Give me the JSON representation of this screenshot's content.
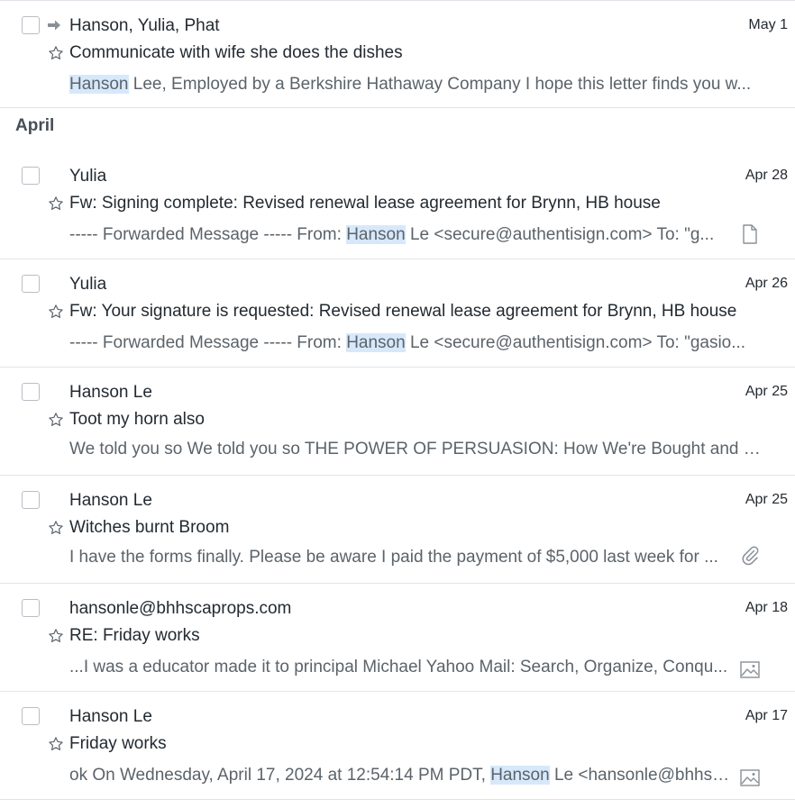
{
  "section": {
    "label": "April"
  },
  "messages": [
    {
      "sender": "Hanson, Yulia, Phat",
      "date": "May 1",
      "subject": "Communicate with wife she does the dishes",
      "snippet_pre": "",
      "snippet_hl": "Hanson",
      "snippet_post": " Lee, Employed by a Berkshire Hathaway Company I hope this letter finds you w...",
      "forwarded": true,
      "attachment": ""
    },
    {
      "sender": "Yulia",
      "date": "Apr 28",
      "subject": "Fw: Signing complete: Revised renewal lease agreement for Brynn, HB house",
      "snippet_pre": "----- Forwarded Message ----- From: ",
      "snippet_hl": "Hanson",
      "snippet_post": " Le <secure@authentisign.com> To: \"g...",
      "forwarded": false,
      "attachment": "document-icon"
    },
    {
      "sender": "Yulia",
      "date": "Apr 26",
      "subject": "Fw: Your signature is requested: Revised renewal lease agreement for Brynn, HB house",
      "snippet_pre": "----- Forwarded Message ----- From: ",
      "snippet_hl": "Hanson",
      "snippet_post": " Le <secure@authentisign.com> To: \"gasio...",
      "forwarded": false,
      "attachment": ""
    },
    {
      "sender": "Hanson Le",
      "date": "Apr 25",
      "subject": "Toot my horn also",
      "snippet_pre": "We told you so We told you so THE POWER OF PERSUASION: How We're Bought and S...",
      "snippet_hl": "",
      "snippet_post": "",
      "forwarded": false,
      "attachment": ""
    },
    {
      "sender": "Hanson Le",
      "date": "Apr 25",
      "subject": "Witches burnt Broom",
      "snippet_pre": "I have the forms finally. Please be aware I paid the payment of $5,000 last week for ...",
      "snippet_hl": "",
      "snippet_post": "",
      "forwarded": false,
      "attachment": "paperclip-icon"
    },
    {
      "sender": "hansonle@bhhscaprops.com",
      "date": "Apr 18",
      "subject": "RE: Friday works",
      "snippet_pre": "...I was a educator made it to principal Michael Yahoo Mail: Search, Organize, Conqu...",
      "snippet_hl": "",
      "snippet_post": "",
      "forwarded": false,
      "attachment": "image-icon"
    },
    {
      "sender": "Hanson Le",
      "date": "Apr 17",
      "subject": "Friday works",
      "snippet_pre": "ok On Wednesday, April 17, 2024 at 12:54:14 PM PDT, ",
      "snippet_hl": "Hanson",
      "snippet_post": " Le <hansonle@bhhsc...",
      "forwarded": false,
      "attachment": "image-icon"
    }
  ]
}
